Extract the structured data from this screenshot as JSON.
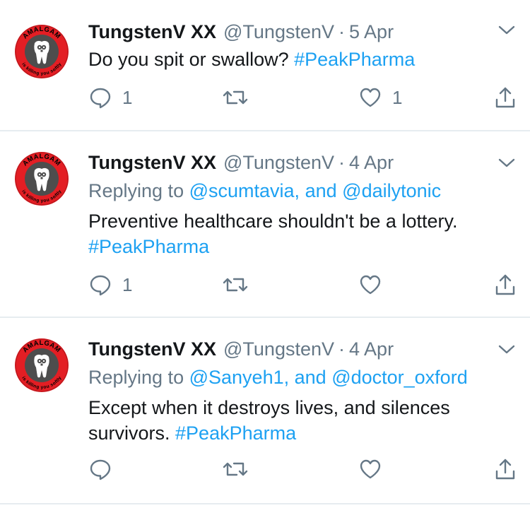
{
  "tweets": [
    {
      "name": "TungstenV XX",
      "handle": "@TungstenV",
      "separator": "·",
      "date": "5 Apr",
      "text": "Do you spit or swallow?",
      "hashtag": "#PeakPharma",
      "replies": "1",
      "likes": "1"
    },
    {
      "name": "TungstenV XX",
      "handle": "@TungstenV",
      "separator": "·",
      "date": "4 Apr",
      "replying_prefix": "Replying to",
      "mention1": "@scumtavia,",
      "mention_joiner": "and",
      "mention2": "@dailytonic",
      "text": "Preventive healthcare shouldn't be a lottery.",
      "hashtag": "#PeakPharma",
      "replies": "1"
    },
    {
      "name": "TungstenV XX",
      "handle": "@TungstenV",
      "separator": "·",
      "date": "4 Apr",
      "replying_prefix": "Replying to",
      "mention1": "@Sanyeh1,",
      "mention_joiner": "and",
      "mention2": "@doctor_oxford",
      "text_line1": "Except when it destroys lives, and silences",
      "text_line2": "survivors.",
      "hashtag": "#PeakPharma"
    }
  ],
  "avatar": {
    "top_text": "AMALGAM",
    "bottom_text": "is killing you softly",
    "ring_color": "#e31e24",
    "inner_color": "#4d4d4d"
  },
  "colors": {
    "link": "#1da1f2",
    "muted": "#657786",
    "text": "#14171a",
    "divider": "#e6ecf0"
  },
  "icons": [
    "reply-icon",
    "retweet-icon",
    "like-icon",
    "share-icon",
    "chevron-down-icon"
  ]
}
